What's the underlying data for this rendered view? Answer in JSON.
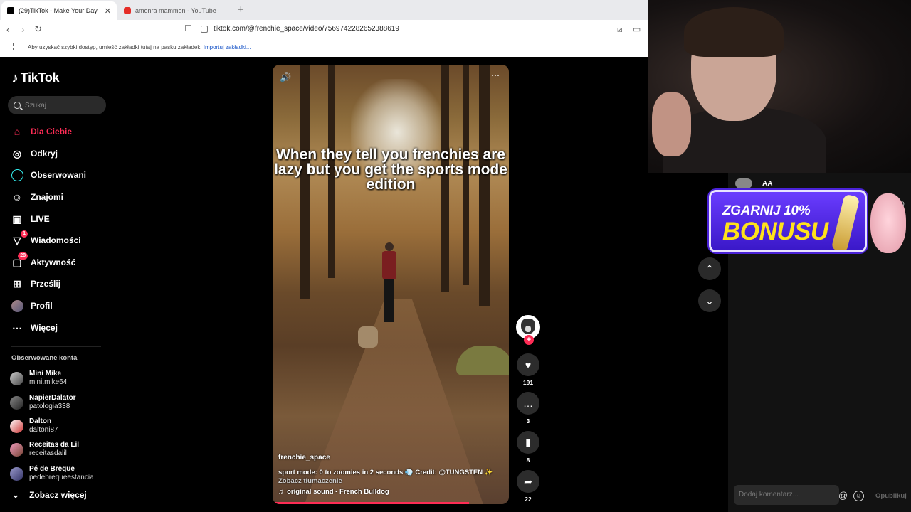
{
  "browser": {
    "tabs": [
      {
        "title": "(29)TikTok - Make Your Day",
        "close": "✕"
      },
      {
        "title": "amonra mammon - YouTube"
      }
    ],
    "new_tab": "+",
    "url": "tiktok.com/@frenchie_space/video/7569742282652388619",
    "bookmarks_hint": "Aby uzyskać szybki dostęp, umieść zakładki tutaj na pasku zakładek.",
    "bookmarks_import": "Importuj zakładki..."
  },
  "sidebar": {
    "logo": "TikTok",
    "search_placeholder": "Szukaj",
    "nav": [
      {
        "label": "Dla Ciebie",
        "icon": "home-icon"
      },
      {
        "label": "Odkryj",
        "icon": "compass-icon"
      },
      {
        "label": "Obserwowani",
        "icon": "following-icon"
      },
      {
        "label": "Znajomi",
        "icon": "friends-icon"
      },
      {
        "label": "LIVE",
        "icon": "live-icon"
      },
      {
        "label": "Wiadomości",
        "icon": "messages-icon",
        "badge": "1"
      },
      {
        "label": "Aktywność",
        "icon": "activity-icon",
        "badge": "28"
      },
      {
        "label": "Prześlij",
        "icon": "upload-icon"
      },
      {
        "label": "Profil",
        "icon": "profile-icon"
      },
      {
        "label": "Więcej",
        "icon": "more-icon"
      }
    ],
    "followed_title": "Obserwowane konta",
    "accounts": [
      {
        "name": "Mini Mike",
        "handle": "mini.mike64"
      },
      {
        "name": "NapierDalator",
        "handle": "patologia338"
      },
      {
        "name": "Dalton",
        "handle": "daltoni87"
      },
      {
        "name": "Receitas da Lil",
        "handle": "receitasdalil"
      },
      {
        "name": "Pé de Breque",
        "handle": "pedebrequeestancia"
      }
    ],
    "see_more": "Zobacz więcej"
  },
  "video": {
    "caption": "When they tell you frenchies are lazy but you get the sports mode edition",
    "username": "frenchie_space",
    "description": "sport mode: 0 to zoomies in 2 seconds 💨 Credit: @TUNGSTEN ✨",
    "translate": "Zobacz tłumaczenie",
    "sound": "original sound - French Bulldog",
    "progress": 0.83
  },
  "actions": {
    "likes": "191",
    "comments": "3",
    "saves": "8",
    "shares": "22"
  },
  "overlay": {
    "comment_user": "AA",
    "comment_likes": "0",
    "banner_line1": "ZGARNIJ 10%",
    "banner_line2": "BONUSU",
    "comment_placeholder": "Dodaj komentarz...",
    "publish": "Opublikuj"
  }
}
